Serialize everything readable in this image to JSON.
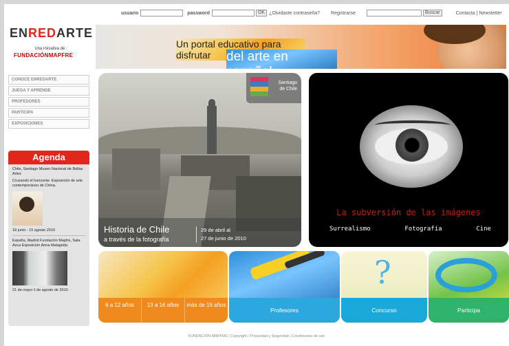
{
  "topbar": {
    "usuario_label": "usuario",
    "password_label": "password",
    "ok_label": "OK",
    "forgot_link": "¿Olvidaste contraseña?",
    "register_link": "Registrarse",
    "search_button": "Buscar",
    "contact_link": "Contacta",
    "separator": "|",
    "newsletter_link": "Newsletter"
  },
  "logo": {
    "part1": "EN",
    "part2": "RED",
    "part3": "ARTE",
    "initiative": "Una iniciativa de :",
    "sponsor": "FUNDACIÓNMAPFRE"
  },
  "banner": {
    "line1": "Un portal educativo para disfrutar",
    "line2": "del arte en español"
  },
  "nav": {
    "items": [
      "CONOCE ENREDARTE",
      "JUEGA Y APRENDE",
      "PROFESORES",
      "PARTICIPA",
      "EXPOSICIONES"
    ]
  },
  "agenda": {
    "title": "Agenda",
    "event1_place": "Chile, Santiago Museo Nacional de Bellas Artes",
    "event1_title": "Cruzando el horizonte. Exposición de arte contemporáneo de China.",
    "event1_dates": "18 junio - 15 agosto 2010",
    "event2_place": "España, Madrid Fundación Mapfre, Sala Azca Exposición Anna Malagrida",
    "event2_dates": "21 de mayo-1 de agosto de 2010"
  },
  "chile": {
    "badge_text_1": "Santiago",
    "badge_text_2": "de Chile",
    "title": "Historia de Chile",
    "subtitle": "a través de la fotografía",
    "dates_1": "29 de abril al",
    "dates_2": "27 de junio de 2010"
  },
  "subversion": {
    "title": "La subversión de las imágenes",
    "links": [
      "Surrealismo",
      "Fotografía",
      "Cine"
    ]
  },
  "tiles": {
    "ages": [
      "6 a 12 años",
      "13 a 16 años",
      "más de 16 años"
    ],
    "profesores": "Profesores",
    "concurso": "Concurso",
    "participa": "Participa"
  },
  "footer": {
    "text": "FUNDACIÓN MAPFRE | Copyright | Privacidad y Seguridad | Condiciones de uso"
  }
}
